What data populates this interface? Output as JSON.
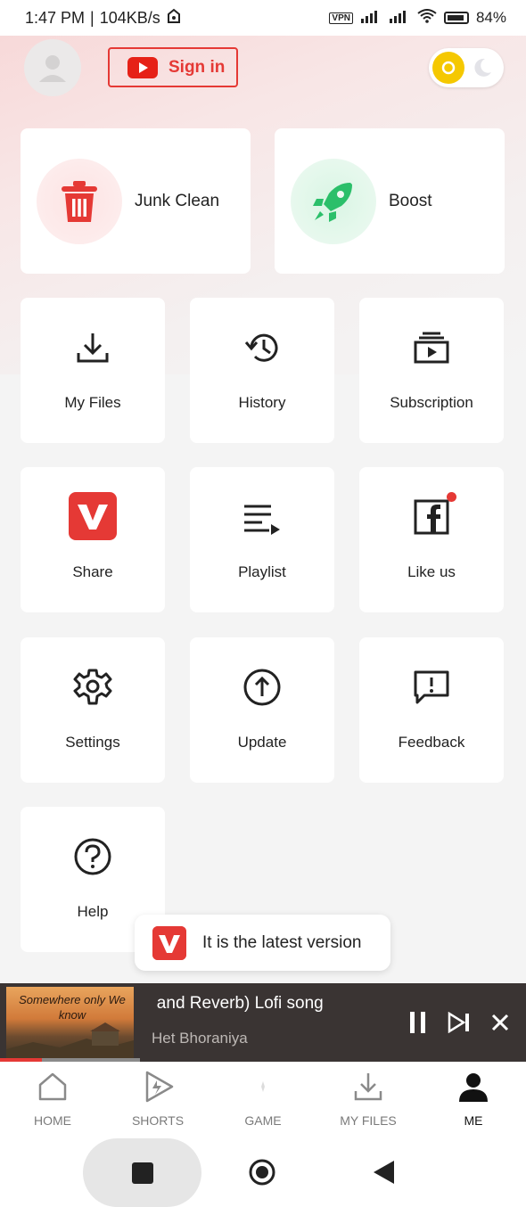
{
  "status_bar": {
    "time": "1:47 PM",
    "speed": "104KB/s",
    "vpn": "VPN",
    "battery": "84%"
  },
  "header": {
    "sign_in_label": "Sign in"
  },
  "big_cards": [
    {
      "label": "Junk Clean",
      "icon": "trash-icon",
      "color": "#e53935"
    },
    {
      "label": "Boost",
      "icon": "rocket-icon",
      "color": "#2bbf6a"
    }
  ],
  "tiles": [
    {
      "label": "My Files",
      "icon": "download-icon"
    },
    {
      "label": "History",
      "icon": "history-icon"
    },
    {
      "label": "Subscription",
      "icon": "subscription-icon"
    },
    {
      "label": "Share",
      "icon": "vidmate-logo-icon"
    },
    {
      "label": "Playlist",
      "icon": "playlist-icon"
    },
    {
      "label": "Like us",
      "icon": "facebook-icon"
    },
    {
      "label": "Settings",
      "icon": "gear-icon"
    },
    {
      "label": "Update",
      "icon": "update-arrow-icon"
    },
    {
      "label": "Feedback",
      "icon": "feedback-icon"
    },
    {
      "label": "Help",
      "icon": "help-icon"
    }
  ],
  "toast": {
    "text": "It is the latest version"
  },
  "player": {
    "title": " and Reverb) Lofi song",
    "artist": "Het Bhoraniya",
    "thumbnail_caption": "Somewhere only We know",
    "progress": 0.3
  },
  "bottom_nav": [
    {
      "label": "HOME",
      "icon": "home-icon",
      "active": false
    },
    {
      "label": "SHORTS",
      "icon": "shorts-icon",
      "active": false
    },
    {
      "label": "GAME",
      "icon": "game-icon",
      "active": false
    },
    {
      "label": "MY FILES",
      "icon": "download-icon",
      "active": false
    },
    {
      "label": "ME",
      "icon": "person-icon",
      "active": true
    }
  ],
  "colors": {
    "accent": "#e53935",
    "sun": "#f5c800",
    "boost_green": "#2bbf6a"
  }
}
